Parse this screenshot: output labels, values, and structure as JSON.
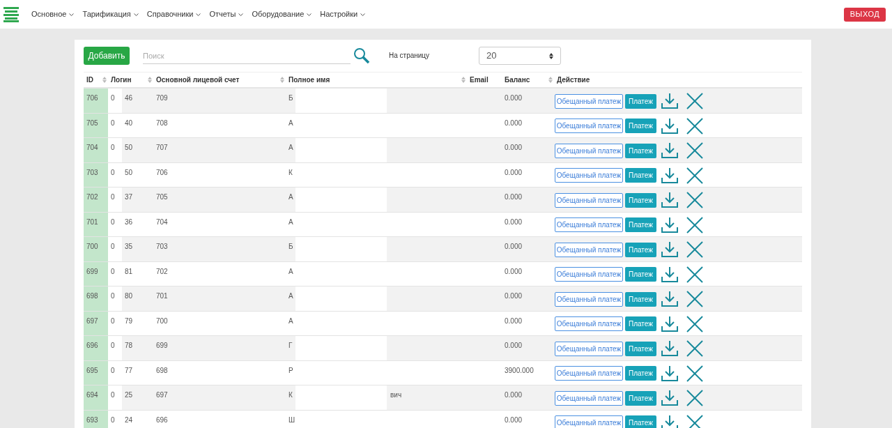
{
  "nav": {
    "items": [
      "Основное",
      "Тарификация",
      "Справочники",
      "Отчеты",
      "Оборудование",
      "Настройки"
    ],
    "logout": "ВЫХОД"
  },
  "toolbar": {
    "add": "Добавить",
    "search": {
      "placeholder": "Поиск"
    },
    "per_page_label": "На страницу",
    "per_page": "20"
  },
  "table": {
    "columns": [
      "ID",
      "Логин",
      "Основной лицевой счет",
      "Полное имя",
      "Email",
      "Баланс",
      "Действие"
    ],
    "rows": [
      {
        "id": "706",
        "column_2": "0",
        "login": "46",
        "account": "709",
        "name": "Б",
        "name_tail": "",
        "balance": "0.000",
        "promise_button": "Обещанный платеж",
        "pay_button": "Платеж"
      },
      {
        "id": "705",
        "column_2": "0",
        "login": "40",
        "account": "708",
        "name": "А",
        "name_tail": "",
        "balance": "0.000",
        "promise_button": "Обещанный платеж",
        "pay_button": "Платеж"
      },
      {
        "id": "704",
        "column_2": "0",
        "login": "50",
        "account": "707",
        "name": "А",
        "name_tail": "",
        "balance": "0.000",
        "promise_button": "Обещанный платеж",
        "pay_button": "Платеж"
      },
      {
        "id": "703",
        "column_2": "0",
        "login": "50",
        "account": "706",
        "name": "К",
        "name_tail": "",
        "balance": "0.000",
        "promise_button": "Обещанный платеж",
        "pay_button": "Платеж"
      },
      {
        "id": "702",
        "column_2": "0",
        "login": "37",
        "account": "705",
        "name": "А",
        "name_tail": "",
        "balance": "0.000",
        "promise_button": "Обещанный платеж",
        "pay_button": "Платеж"
      },
      {
        "id": "701",
        "column_2": "0",
        "login": "36",
        "account": "704",
        "name": "А",
        "name_tail": "",
        "balance": "0.000",
        "promise_button": "Обещанный платеж",
        "pay_button": "Платеж"
      },
      {
        "id": "700",
        "column_2": "0",
        "login": "35",
        "account": "703",
        "name": "Б",
        "name_tail": "",
        "balance": "0.000",
        "promise_button": "Обещанный платеж",
        "pay_button": "Платеж"
      },
      {
        "id": "699",
        "column_2": "0",
        "login": "81",
        "account": "702",
        "name": "А",
        "name_tail": "",
        "balance": "0.000",
        "promise_button": "Обещанный платеж",
        "pay_button": "Платеж"
      },
      {
        "id": "698",
        "column_2": "0",
        "login": "80",
        "account": "701",
        "name": "А",
        "name_tail": "",
        "balance": "0.000",
        "promise_button": "Обещанный платеж",
        "pay_button": "Платеж"
      },
      {
        "id": "697",
        "column_2": "0",
        "login": "79",
        "account": "700",
        "name": "А",
        "name_tail": "",
        "balance": "0.000",
        "promise_button": "Обещанный платеж",
        "pay_button": "Платеж"
      },
      {
        "id": "696",
        "column_2": "0",
        "login": "78",
        "account": "699",
        "name": "Г",
        "name_tail": "",
        "balance": "0.000",
        "promise_button": "Обещанный платеж",
        "pay_button": "Платеж"
      },
      {
        "id": "695",
        "column_2": "0",
        "login": "77",
        "account": "698",
        "name": "Р",
        "name_tail": "",
        "balance": "3900.000",
        "promise_button": "Обещанный платеж",
        "pay_button": "Платеж"
      },
      {
        "id": "694",
        "column_2": "0",
        "login": "25",
        "account": "697",
        "name": "К",
        "name_tail": "вич",
        "balance": "0.000",
        "promise_button": "Обещанный платеж",
        "pay_button": "Платеж"
      },
      {
        "id": "693",
        "column_2": "0",
        "login": "24",
        "account": "696",
        "name": "Ш",
        "name_tail": "",
        "balance": "0.000",
        "promise_button": "Обещанный платеж",
        "pay_button": "Платеж"
      }
    ]
  }
}
